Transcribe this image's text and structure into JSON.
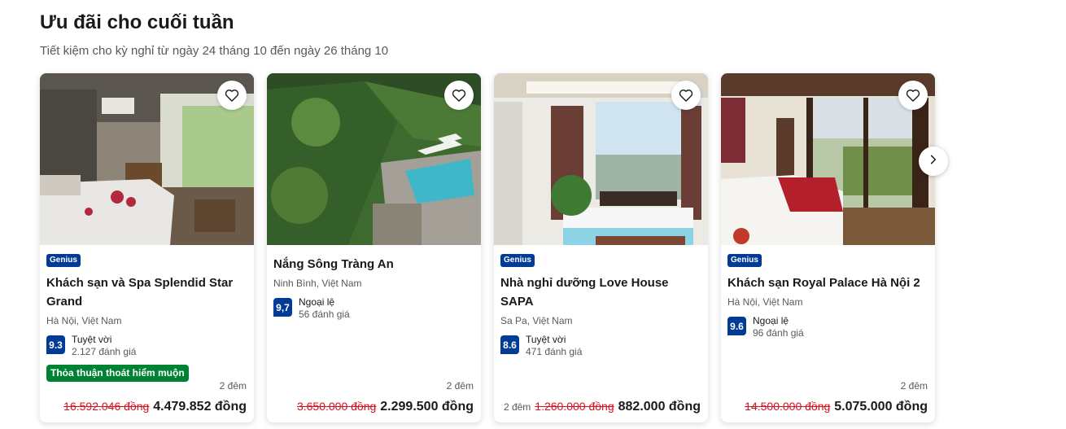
{
  "section": {
    "title": "Ưu đãi cho cuối tuần",
    "subtitle": "Tiết kiệm cho kỳ nghỉ từ ngày 24 tháng 10 đến ngày 26 tháng 10"
  },
  "cards": [
    {
      "genius": "Genius",
      "name": "Khách sạn và Spa Splendid Star Grand",
      "location": "Hà Nội, Việt Nam",
      "score": "9.3",
      "rating_word": "Tuyệt vời",
      "reviews": "2.127 đánh giá",
      "deal": "Thỏa thuận thoát hiểm muộn",
      "nights": "2 đêm",
      "old_price": "16.592.046 đồng",
      "new_price": "4.479.852 đồng"
    },
    {
      "name": "Nắng Sông Tràng An",
      "location": "Ninh Bình, Việt Nam",
      "score": "9,7",
      "rating_word": "Ngoại lệ",
      "reviews": "56 đánh giá",
      "nights": "2 đêm",
      "old_price": "3.650.000 đồng",
      "new_price": "2.299.500 đồng"
    },
    {
      "genius": "Genius",
      "name": "Nhà nghỉ dưỡng Love House SAPA",
      "location": "Sa Pa, Việt Nam",
      "score": "8.6",
      "rating_word": "Tuyệt vời",
      "reviews": "471 đánh giá",
      "nights": "2 đêm",
      "old_price": "1.260.000 đồng",
      "new_price": "882.000 đồng"
    },
    {
      "genius": "Genius",
      "name": "Khách sạn Royal Palace Hà Nội 2",
      "location": "Hà Nội, Việt Nam",
      "score": "9.6",
      "rating_word": "Ngoại lệ",
      "reviews": "96 đánh giá",
      "nights": "2 đêm",
      "old_price": "14.500.000 đồng",
      "new_price": "5.075.000 đồng"
    }
  ],
  "icons": {
    "favorite": "heart-icon",
    "next": "chevron-right-icon"
  },
  "colors": {
    "brand": "#003b95",
    "deal_green": "#008234",
    "strike_red": "#d4111e"
  }
}
